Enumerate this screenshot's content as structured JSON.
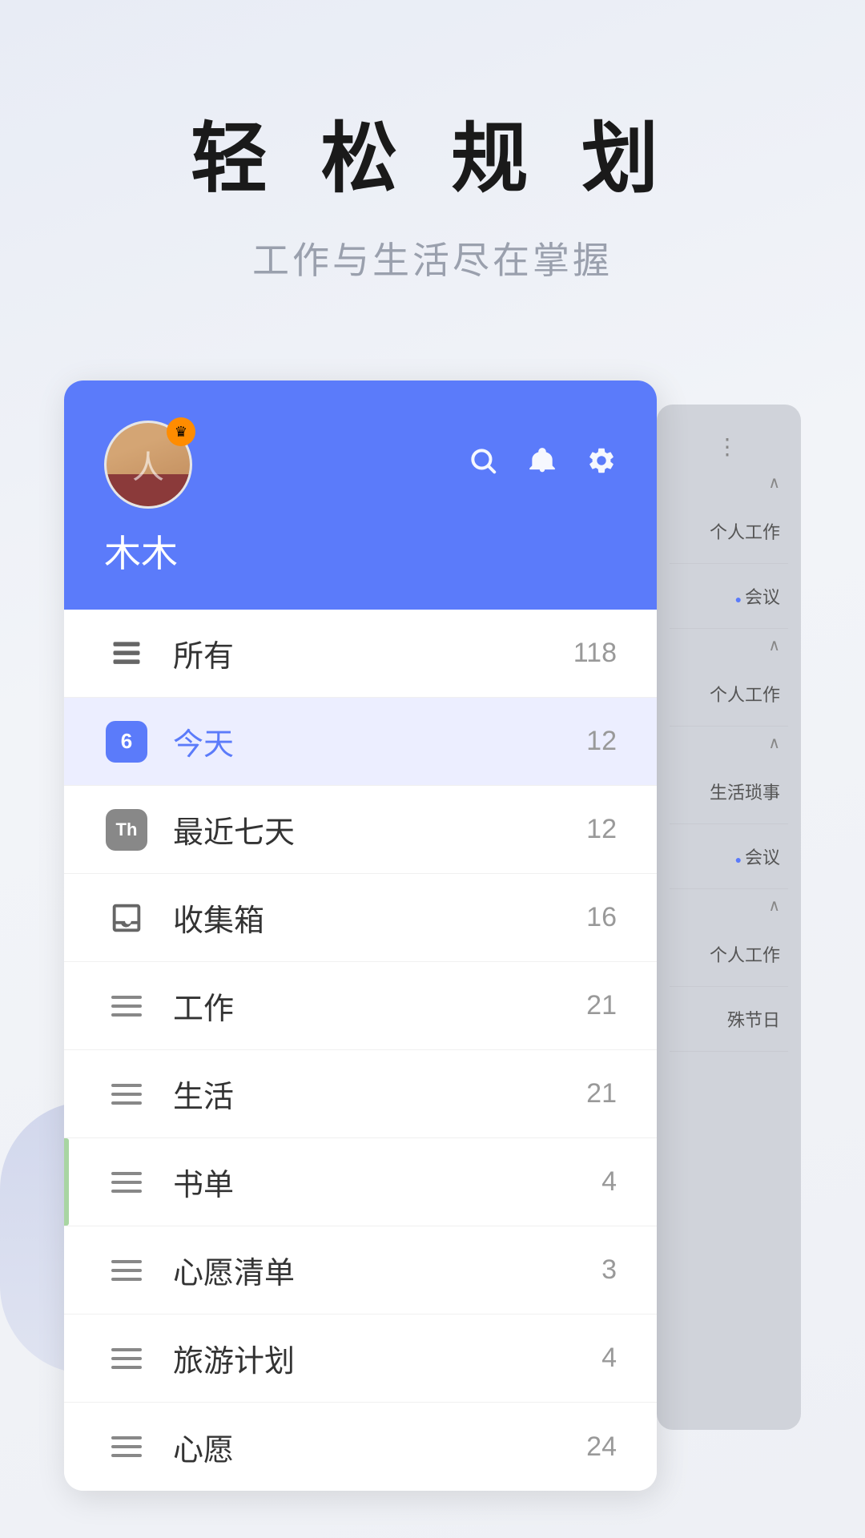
{
  "page": {
    "bg_color": "#eef0f5"
  },
  "header": {
    "main_title": "轻 松 规 划",
    "sub_title": "工作与生活尽在掌握"
  },
  "app": {
    "user": {
      "name": "木木",
      "premium": true,
      "crown_icon": "👑"
    },
    "header_icons": {
      "search": "🔍",
      "bell": "🔔",
      "settings": "⚙️"
    },
    "menu_items": [
      {
        "id": "all",
        "icon_type": "stack",
        "label": "所有",
        "count": "118",
        "active": false
      },
      {
        "id": "today",
        "icon_type": "calendar-6",
        "label": "今天",
        "count": "12",
        "active": true
      },
      {
        "id": "week",
        "icon_type": "calendar-th",
        "label": "最近七天",
        "count": "12",
        "active": false
      },
      {
        "id": "inbox",
        "icon_type": "inbox",
        "label": "收集箱",
        "count": "16",
        "active": false
      },
      {
        "id": "work",
        "icon_type": "lines",
        "label": "工作",
        "count": "21",
        "active": false
      },
      {
        "id": "life",
        "icon_type": "lines",
        "label": "生活",
        "count": "21",
        "active": false
      },
      {
        "id": "books",
        "icon_type": "lines",
        "label": "书单",
        "count": "4",
        "active": false
      },
      {
        "id": "wishes",
        "icon_type": "lines",
        "label": "心愿清单",
        "count": "3",
        "active": false
      },
      {
        "id": "travel",
        "icon_type": "lines",
        "label": "旅游计划",
        "count": "4",
        "active": false
      },
      {
        "id": "wish2",
        "icon_type": "lines",
        "label": "心愿",
        "count": "24",
        "active": false
      }
    ],
    "side_panel": {
      "items": [
        {
          "text": "个人工作",
          "type": "plain"
        },
        {
          "text": "会议",
          "type": "dot"
        },
        {
          "text": "个人工作",
          "type": "plain"
        },
        {
          "text": "生活琐事",
          "type": "plain"
        },
        {
          "text": "会议",
          "type": "dot"
        },
        {
          "text": "个人工作",
          "type": "plain"
        },
        {
          "text": "殊节日",
          "type": "plain"
        }
      ]
    }
  }
}
